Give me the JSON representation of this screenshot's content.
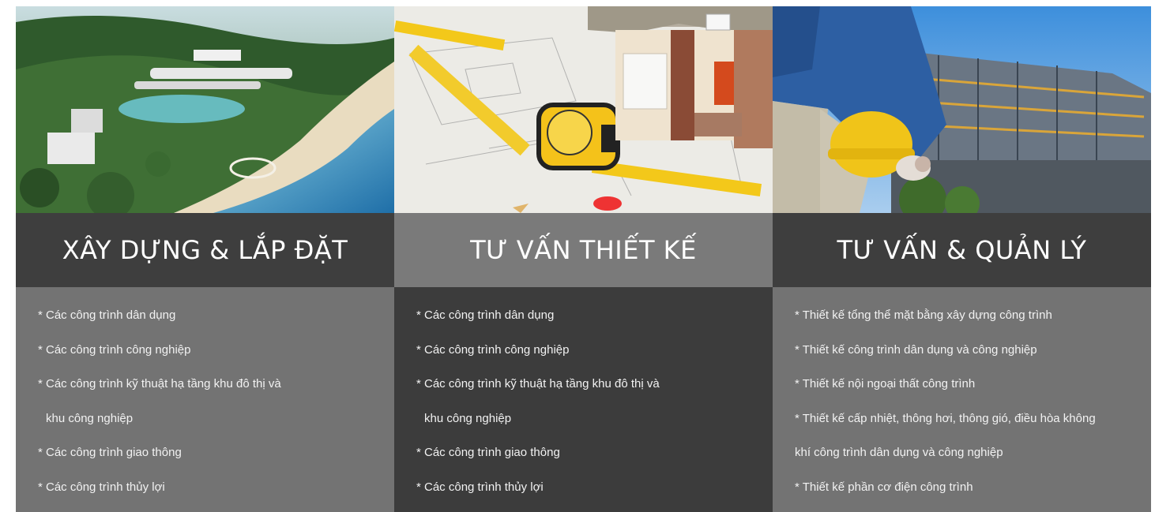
{
  "panels": [
    {
      "title": "XÂY DỰNG & LẮP ĐẶT",
      "lines": [
        "* Các công trình dân dụng",
        "* Các công trình công nghiệp",
        "* Các công trình kỹ thuật hạ tầng khu đô thị và",
        "khu công nghiệp",
        "* Các công trình giao thông",
        "* Các công trình thủy lợi"
      ]
    },
    {
      "title": "TƯ VẤN THIẾT KẾ",
      "lines": [
        "* Các công trình dân dụng",
        "* Các công trình công nghiệp",
        "* Các công trình kỹ thuật hạ tầng khu đô thị và",
        "khu công nghiệp",
        "* Các công trình giao thông",
        "* Các công trình thủy lợi"
      ]
    },
    {
      "title": "TƯ VẤN & QUẢN LÝ",
      "lines": [
        "* Thiết kế tổng thể mặt bằng xây dựng công trình",
        "* Thiết kế công trình dân dụng và công nghiệp",
        "* Thiết kế nội ngoại thất công trình",
        "* Thiết kế cấp nhiệt, thông hơi, thông gió, điều hòa không",
        "khí công trình dân dụng và công nghiệp",
        "* Thiết kế phần cơ điện công trình"
      ]
    }
  ],
  "colors": {
    "title_dark": "#3e3e3e",
    "title_mid": "#7a7a7a",
    "body_light": "#737373",
    "body_dark": "#3c3c3c",
    "text": "#ffffff"
  },
  "images": {
    "panel1": "resort-beach-aerial",
    "panel2": "measuring-tape-house-blueprint",
    "panel3": "worker-yellow-hardhat-building"
  }
}
